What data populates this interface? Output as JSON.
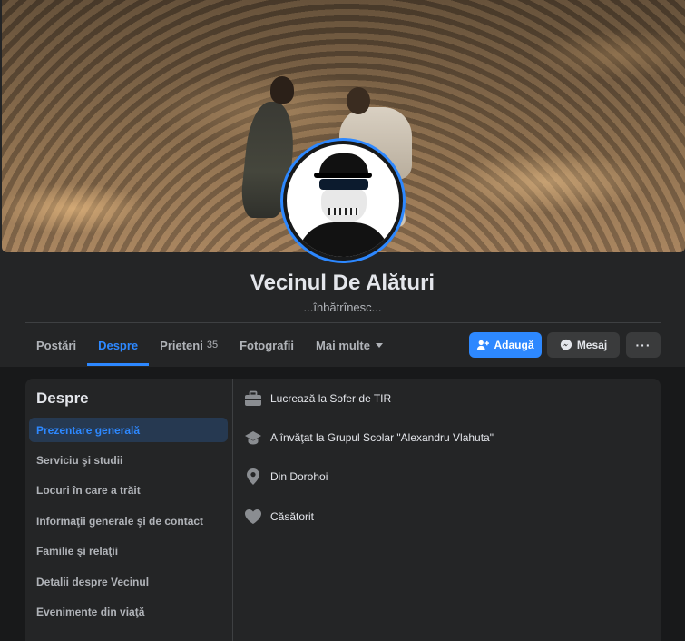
{
  "profile": {
    "name": "Vecinul De Alături",
    "bio": "...înbătrînesc..."
  },
  "tabs": [
    {
      "label": "Postări"
    },
    {
      "label": "Despre",
      "active": true
    },
    {
      "label": "Prieteni",
      "count": "35"
    },
    {
      "label": "Fotografii"
    },
    {
      "label": "Mai multe"
    }
  ],
  "actions": {
    "add_label": "Adaugă",
    "message_label": "Mesaj",
    "more_label": "···"
  },
  "about": {
    "title": "Despre",
    "sections": [
      {
        "label": "Prezentare generală",
        "active": true
      },
      {
        "label": "Serviciu şi studii"
      },
      {
        "label": "Locuri în care a trăit"
      },
      {
        "label": "Informaţii generale şi de contact"
      },
      {
        "label": "Familie şi relaţii"
      },
      {
        "label": "Detalii despre Vecinul"
      },
      {
        "label": "Evenimente din viaţă"
      }
    ],
    "details": [
      {
        "icon": "briefcase-icon",
        "text": "Lucrează la Sofer de TIR"
      },
      {
        "icon": "graduation-cap-icon",
        "text": "A învăţat la Grupul Scolar \"Alexandru Vlahuta\""
      },
      {
        "icon": "location-pin-icon",
        "text": "Din Dorohoi"
      },
      {
        "icon": "heart-icon",
        "text": "Căsătorit"
      }
    ]
  },
  "colors": {
    "accent": "#2d88ff",
    "card": "#242526",
    "background": "#18191a"
  }
}
